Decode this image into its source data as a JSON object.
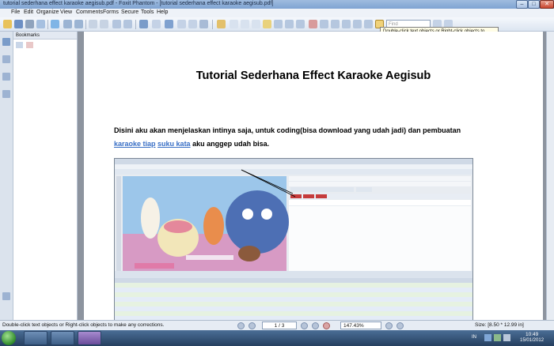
{
  "window": {
    "title": "tutorial sederhana effect karaoke aegisub.pdf - Foxit Phantom - [tutorial sederhana effect karaoke aegisub.pdf]"
  },
  "menu": [
    "File",
    "Edit",
    "Organize",
    "View",
    "Comments",
    "Forms",
    "Secure",
    "Tools",
    "Help"
  ],
  "toolbar": {
    "find_placeholder": "Find"
  },
  "tooltip": "Double-click text objects or Right-click  objects to make any corrections.",
  "left_panel": {
    "bookmarks_label": "Bookmarks"
  },
  "document": {
    "title": "Tutorial Sederhana Effect Karaoke Aegisub",
    "para_part1": "Disini aku akan menjelaskan intinya saja, untuk coding(bisa download yang udah jadi) dan pembuatan",
    "link1": "karaoke tiap",
    "link2": "suku kata",
    "para_part2": " aku anggep udah bisa."
  },
  "statusbar": {
    "hint": "Double-click text objects or Right-click  objects to make any corrections.",
    "page": "1 / 3",
    "zoom": "147.43%",
    "size": "Size: [8.50 * 12.99 in]"
  },
  "taskbar": {
    "lang": "IN",
    "time": "10:49",
    "date": "15/01/2012"
  },
  "colors": {
    "link": "#3a70c6",
    "titlebar": "#9fbcdf",
    "page_bg": "#ffffff"
  }
}
